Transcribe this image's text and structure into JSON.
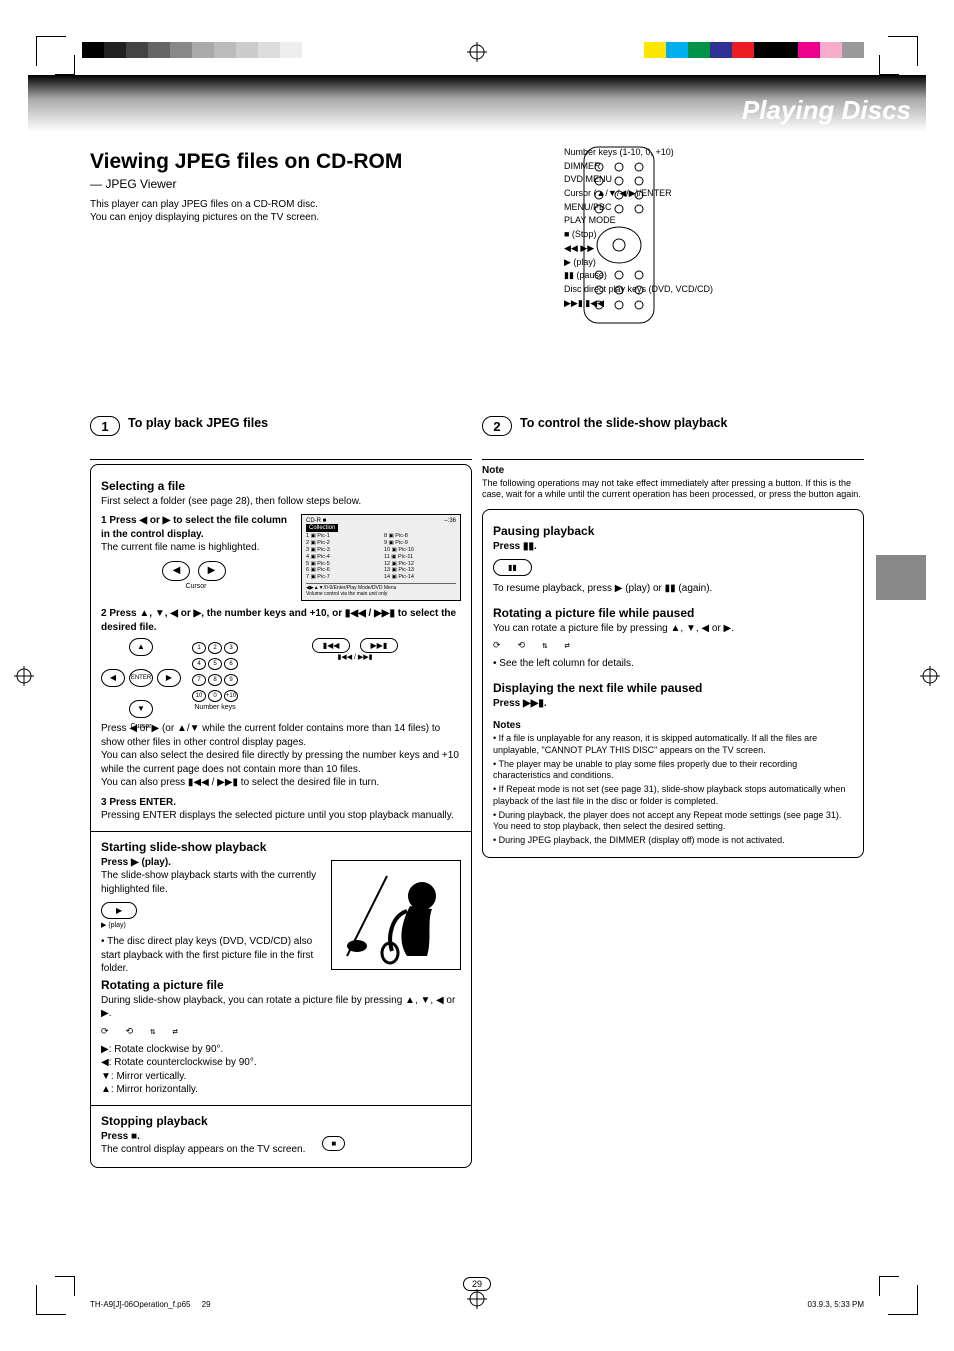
{
  "gradient_title": "Playing Discs",
  "header": {
    "title": "Viewing JPEG files on CD-ROM",
    "sub1": "— JPEG Viewer",
    "sub2": "This player can play JPEG files on a CD-ROM disc.",
    "sub3": "You can enjoy displaying pictures on the TV screen."
  },
  "callouts": {
    "c0": "Number keys (1-10, 0, +10)",
    "c1": "DIMMER",
    "c2": "DVD MENU",
    "c3": "Cursor (▲/▼/◀/▶)/ENTER",
    "c4": "MENU/PBC",
    "c5": "PLAY MODE",
    "c6": "■ (Stop)",
    "c7": "◀◀ ▶▶",
    "c8": "▶ (play)",
    "c9": "▮▮ (pause)",
    "c10": "Disc direct play keys (DVD, VCD/CD)",
    "c11": "▶▶▮ ▮◀◀"
  },
  "step1": {
    "title": "To play back JPEG files",
    "heading": "Selecting a file",
    "p1": "First select a folder (see page 28), then follow steps below.",
    "sub1": "1  Press ◀ or ▶ to select the file column in the control display.",
    "sub1_note": "The current file name is highlighted.",
    "sub2": "2  Press ▲, ▼, ◀ or ▶, the number keys and +10, or ▮◀◀ / ▶▶▮ to select the desired file.",
    "sub2_a": "Press ◀ or ▶ (or ▲/▼ while the current folder contains more than 14 files) to show other files in other control display pages.",
    "sub2_b": "You can also select the desired file directly by pressing the number keys and +10 while the current page does not contain more than 10 files.",
    "sub2_c": "You can also press ▮◀◀ / ▶▶▮ to select the desired file in turn.",
    "sub3": "3  Press ENTER.",
    "sub3_a": "Pressing ENTER displays the selected picture until you stop playback manually.",
    "play_heading": "Starting slide-show playback",
    "play_p1": "Press ▶ (play).",
    "play_p2": "The slide-show playback starts with the currently highlighted file.",
    "play_note": "• The disc direct play keys (DVD, VCD/CD) also start playback with the first picture file in the first folder.",
    "rot_heading": "Rotating a picture file",
    "rot_p": "During slide-show playback, you can rotate a picture file by pressing ▲, ▼, ◀ or ▶.",
    "rot_a": "▶: Rotate clockwise by 90°.",
    "rot_b": "◀: Rotate counterclockwise by 90°.",
    "rot_c": "▼: Mirror vertically.",
    "rot_d": "▲: Mirror horizontally.",
    "stop_heading": "Stopping playback",
    "stop_p1": "Press ■.",
    "stop_p2": "The control display appears on the TV screen."
  },
  "step2": {
    "title": "To control the slide-show playback",
    "note_title": "Note",
    "note_body": "The following operations may not take effect immediately after pressing a button. If this is the case, wait for a while until the current operation has been processed, or press the button again.",
    "pause_heading": "Pausing playback",
    "pause_p1": "Press ▮▮.",
    "pause_p2": "To resume playback, press ▶ (play) or ▮▮ (again).",
    "rot_heading": "Rotating a picture file while paused",
    "rot_p": "You can rotate a picture file by pressing ▲, ▼, ◀ or ▶.",
    "rot_note": "• See the left column for details.",
    "next_heading": "Displaying the next file while paused",
    "next_p": "Press ▶▶▮.",
    "notes_title": "Notes",
    "notes1": "• If a file is unplayable for any reason, it is skipped automatically. If all the files are unplayable, \"CANNOT PLAY THIS DISC\" appears on the TV screen.",
    "notes2": "• The player may be unable to play some files properly due to their recording characteristics and conditions.",
    "notes3": "• If Repeat mode is not set (see page 31), slide-show playback stops automatically when playback of the last file in the disc or folder is completed.",
    "notes4": "• During playback, the player does not accept any Repeat mode settings (see page 31). You need to stop playback, then select the desired setting.",
    "notes5": "• During JPEG playback, the DIMMER (display off) mode is not activated."
  },
  "cursor_label": "Cursor",
  "numkeys_label": "Number keys",
  "enter_label": "ENTER",
  "play_label": "▶ (play)",
  "skip_label": "▮◀◀ / ▶▶▮",
  "tv_screen": {
    "header_left": "CD-R ■",
    "header_right": "–:36",
    "folder": "Collection",
    "files_l": [
      "1 ▣ Pic-1",
      "2 ▣ Pic-2",
      "3 ▣ Pic-3",
      "4 ▣ Pic-4",
      "5 ▣ Pic-5",
      "6 ▣ Pic-6",
      "7 ▣ Pic-7"
    ],
    "files_r": [
      "8 ▣ Pic-8",
      "9 ▣ Pic-9",
      "10 ▣ Pic-10",
      "11 ▣ Pic-11",
      "12 ▣ Pic-12",
      "13 ▣ Pic-13",
      "14 ▣ Pic-14"
    ],
    "foot1": "◀▶▲▼/0-9/Enter/Play Mode/DVD Menu",
    "foot2": "Volume control via the main unit only"
  },
  "keypad": {
    "k1": "1",
    "k2": "2",
    "k3": "3",
    "k4": "4",
    "k5": "5",
    "k6": "6",
    "k7": "7",
    "k8": "8",
    "k9": "9",
    "k10": "10",
    "k0": "0",
    "kp": "+10"
  },
  "meta": {
    "page": "29",
    "left": "29",
    "right": "03.9.3, 5:33 PM",
    "file": "TH-A9[J]-06Operation_f.p65"
  }
}
